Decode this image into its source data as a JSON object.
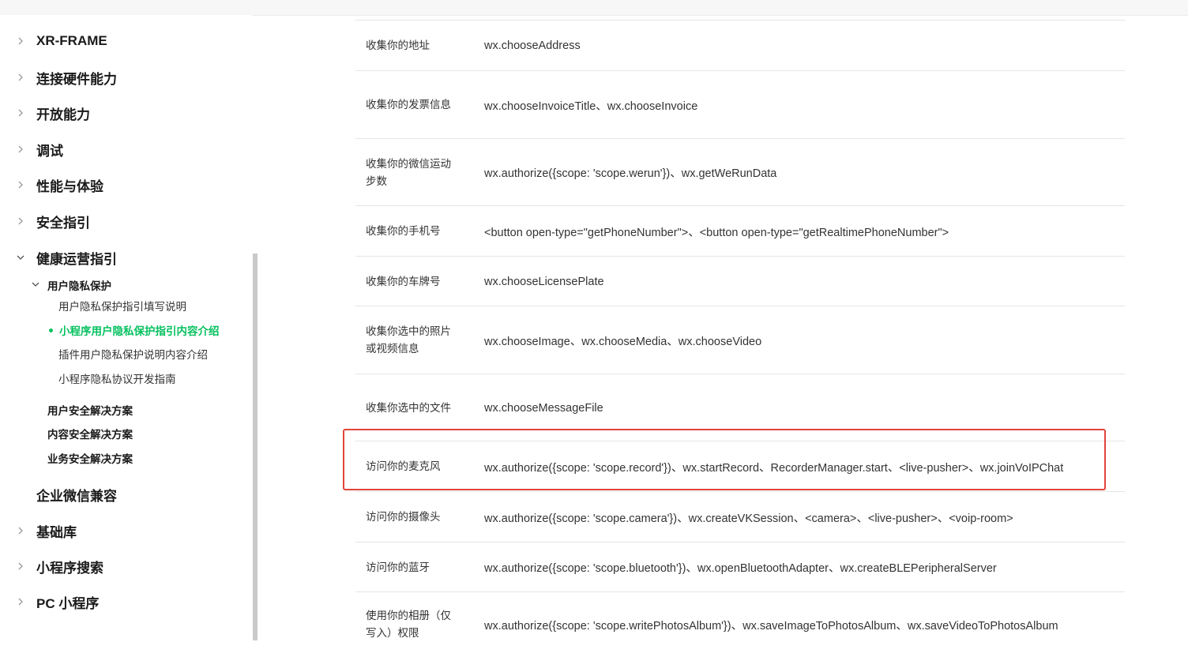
{
  "sidebar": {
    "top_items": [
      {
        "label": "XR-FRAME"
      },
      {
        "label": "连接硬件能力"
      },
      {
        "label": "开放能力"
      },
      {
        "label": "调试"
      },
      {
        "label": "性能与体验"
      },
      {
        "label": "安全指引"
      }
    ],
    "expanded": {
      "label": "健康运营指引",
      "group": {
        "label": "用户隐私保护",
        "children": [
          {
            "label": "用户隐私保护指引填写说明"
          },
          {
            "label": "小程序用户隐私保护指引内容介绍",
            "active": true
          },
          {
            "label": "插件用户隐私保护说明内容介绍"
          },
          {
            "label": "小程序隐私协议开发指南"
          }
        ]
      },
      "other_groups": [
        {
          "label": "用户安全解决方案"
        },
        {
          "label": "内容安全解决方案"
        },
        {
          "label": "业务安全解决方案"
        }
      ]
    },
    "bottom_items": [
      {
        "label": "企业微信兼容",
        "has_chevron": false
      },
      {
        "label": "基础库",
        "has_chevron": true
      },
      {
        "label": "小程序搜索",
        "has_chevron": true
      },
      {
        "label": "PC 小程序",
        "has_chevron": true
      }
    ]
  },
  "table": {
    "rows": [
      {
        "desc": "收集你的地址",
        "api": "wx.chooseAddress"
      },
      {
        "desc": "收集你的发票信息",
        "api": "wx.chooseInvoiceTitle、wx.chooseInvoice"
      },
      {
        "desc": "收集你的微信运动步数",
        "api": "wx.authorize({scope: 'scope.werun'})、wx.getWeRunData"
      },
      {
        "desc": "收集你的手机号",
        "api": "<button open-type=\"getPhoneNumber\">、<button open-type=\"getRealtimePhoneNumber\">"
      },
      {
        "desc": "收集你的车牌号",
        "api": "wx.chooseLicensePlate"
      },
      {
        "desc": "收集你选中的照片或视频信息",
        "api": "wx.chooseImage、wx.chooseMedia、wx.chooseVideo"
      },
      {
        "desc": "收集你选中的文件",
        "api": "wx.chooseMessageFile"
      },
      {
        "desc": "访问你的麦克风",
        "api": "wx.authorize({scope: 'scope.record'})、wx.startRecord、RecorderManager.start、<live-pusher>、wx.joinVoIPChat",
        "highlighted": true
      },
      {
        "desc": "访问你的摄像头",
        "api": "wx.authorize({scope: 'scope.camera'})、wx.createVKSession、<camera>、<live-pusher>、<voip-room>"
      },
      {
        "desc": "访问你的蓝牙",
        "api": "wx.authorize({scope: 'scope.bluetooth'})、wx.openBluetoothAdapter、wx.createBLEPeripheralServer"
      },
      {
        "desc": "使用你的相册（仅写入）权限",
        "api": "wx.authorize({scope: 'scope.writePhotosAlbum'})、wx.saveImageToPhotosAlbum、wx.saveVideoToPhotosAlbum"
      }
    ]
  },
  "colors": {
    "accent": "#07c160",
    "highlight_border": "#e0443a"
  },
  "icons": {
    "collapsed": "chevron-right-icon",
    "expanded": "chevron-down-icon"
  }
}
